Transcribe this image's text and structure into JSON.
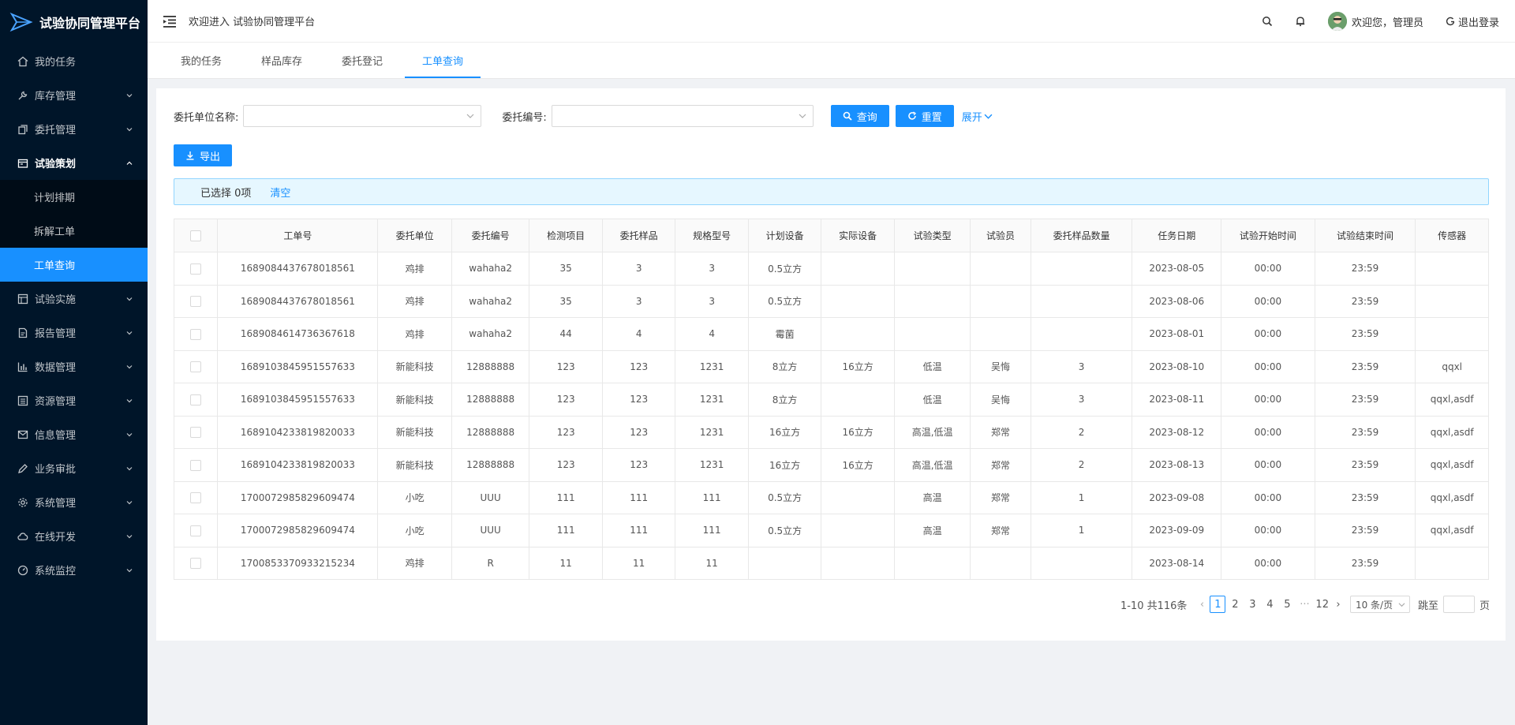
{
  "app": {
    "title": "试验协同管理平台"
  },
  "sidebar": {
    "items": [
      {
        "label": "我的任务",
        "icon": "home-icon",
        "has_children": false
      },
      {
        "label": "库存管理",
        "icon": "wrench-icon",
        "has_children": true
      },
      {
        "label": "委托管理",
        "icon": "copy-icon",
        "has_children": true
      },
      {
        "label": "试验策划",
        "icon": "schedule-icon",
        "has_children": true,
        "open": true,
        "children": [
          {
            "label": "计划排期",
            "active": false
          },
          {
            "label": "拆解工单",
            "active": false
          },
          {
            "label": "工单查询",
            "active": true
          }
        ]
      },
      {
        "label": "试验实施",
        "icon": "table-icon",
        "has_children": true
      },
      {
        "label": "报告管理",
        "icon": "report-icon",
        "has_children": true
      },
      {
        "label": "数据管理",
        "icon": "bar-chart-icon",
        "has_children": true
      },
      {
        "label": "资源管理",
        "icon": "list-icon",
        "has_children": true
      },
      {
        "label": "信息管理",
        "icon": "mail-icon",
        "has_children": true
      },
      {
        "label": "业务审批",
        "icon": "pen-icon",
        "has_children": true
      },
      {
        "label": "系统管理",
        "icon": "gear-icon",
        "has_children": true
      },
      {
        "label": "在线开发",
        "icon": "cloud-icon",
        "has_children": true
      },
      {
        "label": "系统监控",
        "icon": "dashboard-icon",
        "has_children": true
      }
    ]
  },
  "header": {
    "welcome": "欢迎进入 试验协同管理平台",
    "user_greeting": "欢迎您，管理员",
    "logout": "退出登录"
  },
  "tabs": [
    {
      "label": "我的任务",
      "active": false
    },
    {
      "label": "样品库存",
      "active": false
    },
    {
      "label": "委托登记",
      "active": false
    },
    {
      "label": "工单查询",
      "active": true
    }
  ],
  "search": {
    "unit_label": "委托单位名称:",
    "code_label": "委托编号:",
    "query_button": "查询",
    "reset_button": "重置",
    "expand": "展开"
  },
  "toolbar": {
    "export": "导出"
  },
  "selection": {
    "text": "已选择 0项",
    "clear": "清空"
  },
  "table": {
    "columns": [
      "工单号",
      "委托单位",
      "委托编号",
      "检测项目",
      "委托样品",
      "规格型号",
      "计划设备",
      "实际设备",
      "试验类型",
      "试验员",
      "委托样品数量",
      "任务日期",
      "试验开始时间",
      "试验结束时间",
      "传感器"
    ],
    "rows": [
      [
        "1689084437678018561",
        "鸡排",
        "wahaha2",
        "35",
        "3",
        "3",
        "0.5立方",
        "",
        "",
        "",
        "",
        "2023-08-05",
        "00:00",
        "23:59",
        ""
      ],
      [
        "1689084437678018561",
        "鸡排",
        "wahaha2",
        "35",
        "3",
        "3",
        "0.5立方",
        "",
        "",
        "",
        "",
        "2023-08-06",
        "00:00",
        "23:59",
        ""
      ],
      [
        "1689084614736367618",
        "鸡排",
        "wahaha2",
        "44",
        "4",
        "4",
        "霉菌",
        "",
        "",
        "",
        "",
        "2023-08-01",
        "00:00",
        "23:59",
        ""
      ],
      [
        "1689103845951557633",
        "新能科技",
        "12888888",
        "123",
        "123",
        "1231",
        "8立方",
        "16立方",
        "低温",
        "吴悔",
        "3",
        "2023-08-10",
        "00:00",
        "23:59",
        "qqxl"
      ],
      [
        "1689103845951557633",
        "新能科技",
        "12888888",
        "123",
        "123",
        "1231",
        "8立方",
        "",
        "低温",
        "吴悔",
        "3",
        "2023-08-11",
        "00:00",
        "23:59",
        "qqxl,asdf"
      ],
      [
        "1689104233819820033",
        "新能科技",
        "12888888",
        "123",
        "123",
        "1231",
        "16立方",
        "16立方",
        "高温,低温",
        "郑常",
        "2",
        "2023-08-12",
        "00:00",
        "23:59",
        "qqxl,asdf"
      ],
      [
        "1689104233819820033",
        "新能科技",
        "12888888",
        "123",
        "123",
        "1231",
        "16立方",
        "16立方",
        "高温,低温",
        "郑常",
        "2",
        "2023-08-13",
        "00:00",
        "23:59",
        "qqxl,asdf"
      ],
      [
        "1700072985829609474",
        "小吃",
        "UUU",
        "111",
        "111",
        "111",
        "0.5立方",
        "",
        "高温",
        "郑常",
        "1",
        "2023-09-08",
        "00:00",
        "23:59",
        "qqxl,asdf"
      ],
      [
        "1700072985829609474",
        "小吃",
        "UUU",
        "111",
        "111",
        "111",
        "0.5立方",
        "",
        "高温",
        "郑常",
        "1",
        "2023-09-09",
        "00:00",
        "23:59",
        "qqxl,asdf"
      ],
      [
        "1700853370933215234",
        "鸡排",
        "R",
        "11",
        "11",
        "11",
        "",
        "",
        "",
        "",
        "",
        "2023-08-14",
        "00:00",
        "23:59",
        ""
      ]
    ]
  },
  "pagination": {
    "total": "1-10 共116条",
    "pages": [
      "1",
      "2",
      "3",
      "4",
      "5"
    ],
    "ellipsis": "···",
    "last": "12",
    "page_size": "10 条/页",
    "jump_label": "跳至",
    "page_suffix": "页"
  },
  "colors": {
    "primary": "#1890ff",
    "sidebar_bg": "#001529",
    "submenu_bg": "#000c17"
  }
}
